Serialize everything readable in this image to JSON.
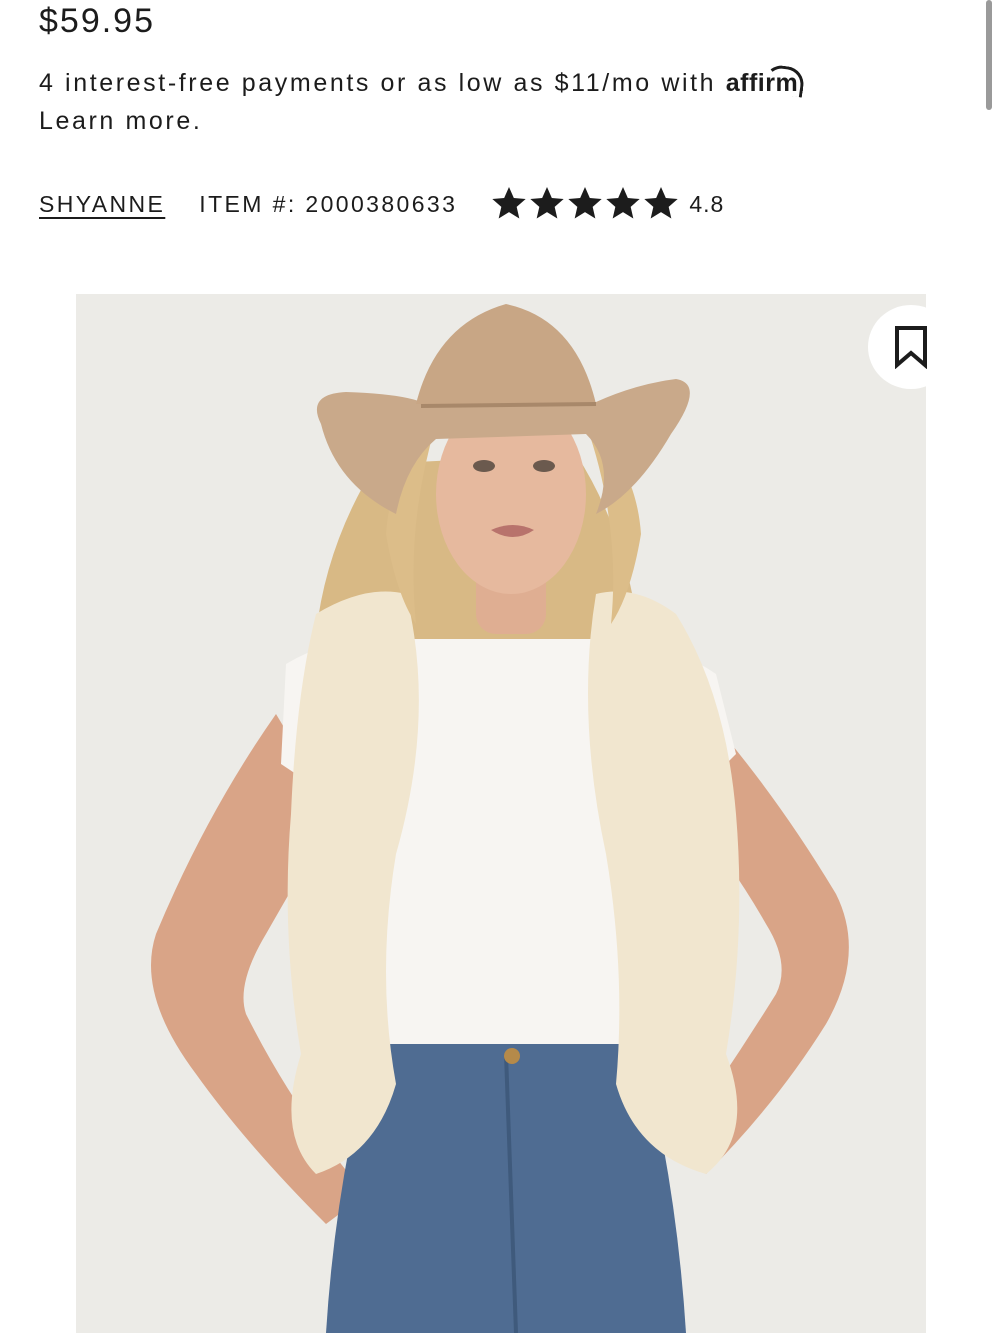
{
  "product": {
    "price": "$59.95",
    "financing_text": "4 interest-free payments or as low as $11/mo with",
    "affirm_label": "affirm",
    "financing_period": ".",
    "learn_more": "Learn more.",
    "brand": "SHYANNE",
    "item_number": "ITEM #: 2000380633",
    "rating_stars": 5,
    "rating": "4.8"
  },
  "image": {
    "description_icon": "product-photo",
    "bookmark_icon": "bookmark-icon"
  },
  "colors": {
    "text": "#1c1c1c",
    "image_bg": "#ecebe7",
    "star": "#1c1c1c"
  }
}
